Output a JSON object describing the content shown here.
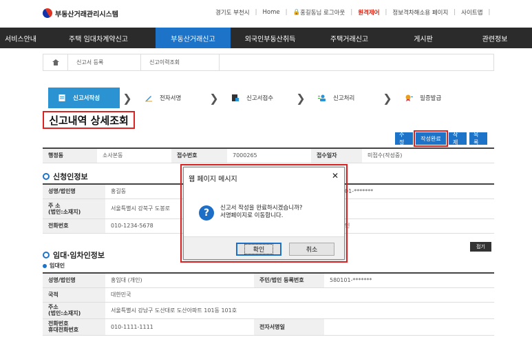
{
  "header": {
    "logo_text": "부동산거래관리시스템",
    "util_links": [
      {
        "label": "경기도 부천시",
        "red": false
      },
      {
        "label": "Home",
        "red": false
      },
      {
        "label": "홍길동님 로그아웃",
        "red": false
      },
      {
        "label": "원격제어",
        "red": true
      },
      {
        "label": "정보격차해소용 페이지",
        "red": false
      },
      {
        "label": "사이트맵",
        "red": false
      }
    ]
  },
  "nav": {
    "items": [
      {
        "label": "서비스안내"
      },
      {
        "label": "주택 임대차계약신고"
      },
      {
        "label": "부동산거래신고"
      },
      {
        "label": "외국인부동산취득"
      },
      {
        "label": "주택거래신고"
      },
      {
        "label": "게시판"
      },
      {
        "label": "관련정보"
      }
    ],
    "active_index": 2
  },
  "breadcrumb": {
    "items": [
      "신고서 등록",
      "신고이력조회"
    ]
  },
  "steps": [
    {
      "label": "신고서작성",
      "icon": "document-icon",
      "active": true
    },
    {
      "label": "전자서명",
      "icon": "pen-icon",
      "active": false
    },
    {
      "label": "신고서접수",
      "icon": "folder-icon",
      "active": false
    },
    {
      "label": "신고처리",
      "icon": "person-icon",
      "active": false
    },
    {
      "label": "필증발급",
      "icon": "certificate-icon",
      "active": false
    }
  ],
  "page_title": "신고내역 상세조회",
  "actions": {
    "edit": "수정",
    "complete": "작성완료",
    "delete": "삭제",
    "list": "목록"
  },
  "summary": {
    "region_label": "행정동",
    "region_value": "소사본동",
    "receipt_no_label": "접수번호",
    "receipt_no_value": "7000265",
    "receipt_date_label": "접수일자",
    "receipt_date_value": "미접수(작성중)"
  },
  "applicant": {
    "section_title": "신청인정보",
    "name_label": "성명/법인명",
    "name_value": "홍길동",
    "id_value": "01-*******",
    "address_label": "주 소\n(법인:소재지)",
    "address_value": "서울특별시 강북구 도봉로",
    "phone_label": "전화번호",
    "phone_value": "010-1234-5678",
    "extra_value": "인"
  },
  "fold_label": "접기",
  "parties": {
    "section_title": "임대·임차인정보",
    "sub_title": "임대인",
    "name_label": "성명/법인명",
    "name_value": "홍임대 (개인)",
    "id_label": "주민/법인 등록번호",
    "id_value": "580101-*******",
    "nation_label": "국적",
    "nation_value": "대한민국",
    "address_label": "주소\n(법인:소재지)",
    "address_value": "서울특별시 강남구 도산대로 도산아파트 101동 101호",
    "phone_label": "전화번호\n휴대전화번호",
    "phone_value": "010-1111-1111",
    "sign_label": "전자서명일",
    "sign_value": ""
  },
  "dialog": {
    "title": "웹 페이지 메시지",
    "message_line1": "신고서 작성을 완료하시겠습니까?",
    "message_line2": "서명페이지로 이동합니다.",
    "ok_label": "확인",
    "cancel_label": "취소",
    "close_glyph": "✕",
    "icon_glyph": "?"
  }
}
